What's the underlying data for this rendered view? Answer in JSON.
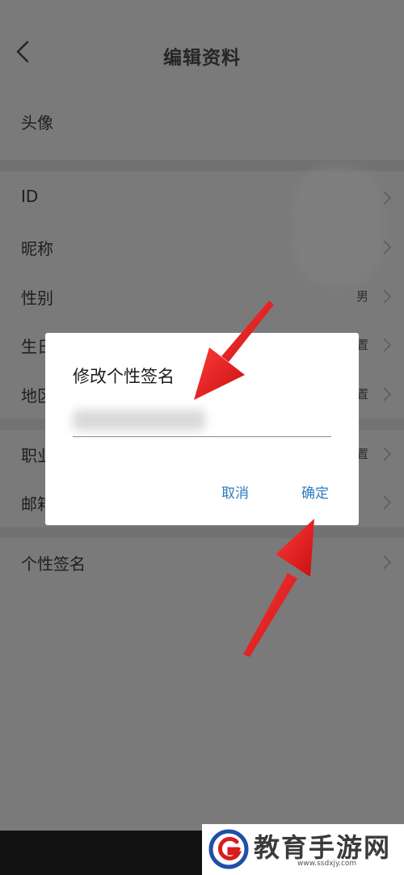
{
  "header": {
    "title": "编辑资料"
  },
  "rows": [
    {
      "label": "头像",
      "value": ""
    },
    {
      "label": "ID",
      "value": ""
    },
    {
      "label": "昵称",
      "value": ""
    },
    {
      "label": "性别",
      "value": "男"
    },
    {
      "label": "生日",
      "value": "置"
    },
    {
      "label": "地区",
      "value": "置"
    },
    {
      "label": "职业",
      "value": "置"
    },
    {
      "label": "邮箱",
      "value": ""
    },
    {
      "label": "个性签名",
      "value": ""
    }
  ],
  "dialog": {
    "title": "修改个性签名",
    "input_value": "",
    "cancel_label": "取消",
    "confirm_label": "确定"
  },
  "watermark": {
    "name": "教育手游网",
    "url": "www.ssdxjy.com"
  },
  "colors": {
    "overlay_bg": "#7a7a7a",
    "dialog_bg": "#ffffff",
    "button_text": "#2d7bbf",
    "arrow": "#e01818",
    "logo_blue": "#1f4fa8",
    "logo_red": "#d81b1b"
  }
}
